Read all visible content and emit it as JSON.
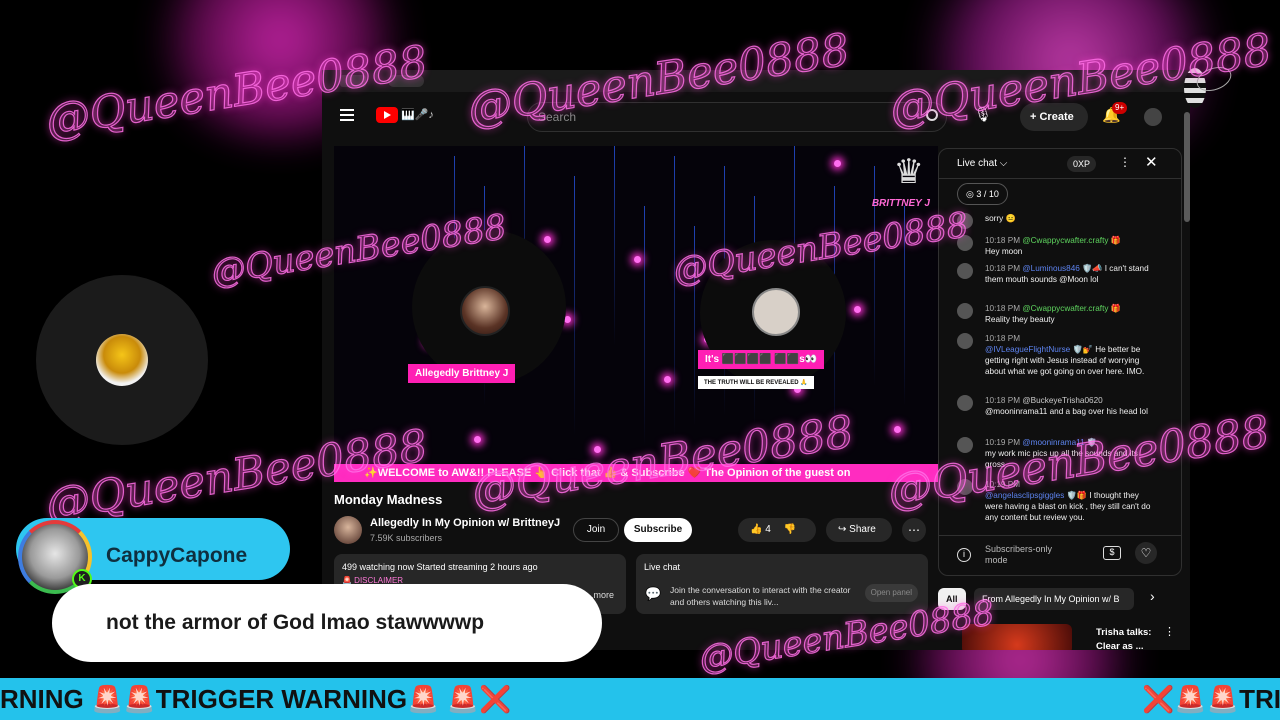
{
  "watermark": "@QueenBee0888",
  "youtube": {
    "search_placeholder": "Search",
    "create_label": "Create",
    "notif_count": "9+",
    "player": {
      "host_name": "Allegedly Brittney J",
      "guest_name": "It's ⬛⬛⬛⬛ ⬛⬛s👀",
      "truth_banner": "THE TRUTH WILL BE REVEALED 🙏",
      "brand_mark": "BRITTNEY J",
      "ticker": "✨WELCOME to AW&!! PLEASE 👆 Click that 👍 & Subscribe ❤️ The Opinion of the guest on"
    },
    "video_title": "Monday Madness",
    "channel_name": "Allegedly In My Opinion w/ BrittneyJ",
    "subscribers": "7.59K subscribers",
    "join_label": "Join",
    "subscribe_label": "Subscribe",
    "like_count": "4",
    "share_label": "Share",
    "description": {
      "stats": "499 watching now  Started streaming 2 hours ago",
      "sub": "🚨 DISCLAIMER",
      "more": "...more"
    },
    "chat_panel": {
      "title": "Live chat",
      "text": "Join the conversation to interact with the creator and others watching this liv...",
      "open_label": "Open panel"
    },
    "live_chat": {
      "title": "Live chat ⌵",
      "xp": "0XP",
      "poll": "3 / 10",
      "messages": [
        {
          "time": "",
          "user": "",
          "text": "sorry 😐"
        },
        {
          "time": "10:18 PM",
          "user": "@Cwappycwafter.crafty 🎁",
          "text": "Hey moon"
        },
        {
          "time": "10:18 PM",
          "user": "@Luminous846 🛡️📣",
          "text": "I can't stand them mouth sounds @Moon lol"
        },
        {
          "time": "10:18 PM",
          "user": "@Cwappycwafter.crafty 🎁",
          "text": "Reality they beauty"
        },
        {
          "time": "10:18 PM",
          "user": "@IVLeagueFlightNurse 🛡️💅",
          "text": "He better be getting right with Jesus instead of worrying about what we got going on over here. IMO."
        },
        {
          "time": "10:18 PM",
          "user": "@BuckeyeTrisha0620",
          "text": "@mooninrama11 and a bag over his head lol"
        },
        {
          "time": "10:19 PM",
          "user": "@mooninrama11 🛡️",
          "text": "my work mic pics up all the sounds and its gross"
        },
        {
          "time": "10:19 PM",
          "user": "@angelasclipsgiggles 🛡️🎁",
          "text": "I thought they were having a blast on kick , they still can't do any content but review you."
        }
      ],
      "subscribers_only": "Subscribers-only mode"
    },
    "chips": {
      "all": "All",
      "from": "From Allegedly In My Opinion w/ B"
    },
    "recommended": {
      "title": "Trisha talks: Clear as ..."
    }
  },
  "comment": {
    "user": "CappyCapone",
    "text": "not the armor of God lmao stawwwwp",
    "platform_badge": "K"
  },
  "bottom_ticker": {
    "left": "RNING 🚨🚨TRIGGER WARNING🚨 🚨❌",
    "right": "❌🚨🚨TRI"
  }
}
